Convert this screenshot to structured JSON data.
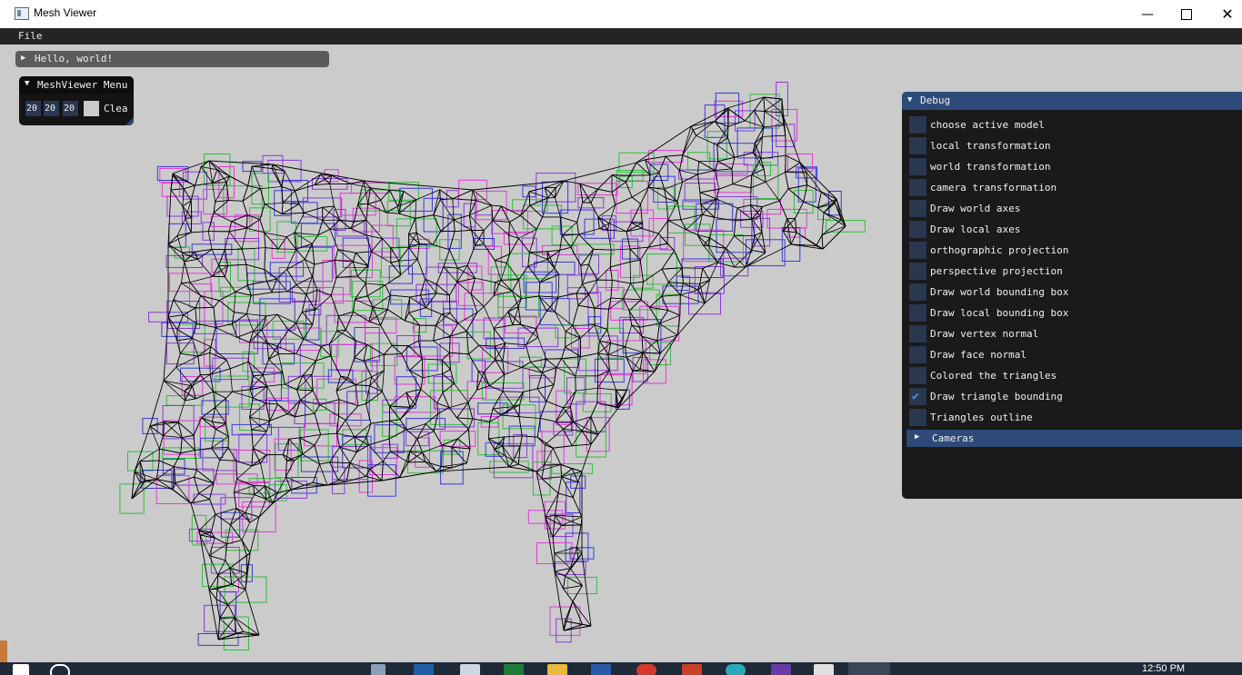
{
  "window": {
    "title": "Mesh Viewer",
    "minimize_icon": "minimize-icon",
    "maximize_icon": "maximize-icon",
    "close_icon": "close-icon"
  },
  "menubar": {
    "file": "File"
  },
  "hello_window": {
    "title": "Hello, world!"
  },
  "meshviewer_menu": {
    "title": "MeshViewer Menu",
    "color_values": [
      "20",
      "20",
      "20"
    ],
    "clear_label": "Clea"
  },
  "debug": {
    "title": "Debug",
    "options": [
      {
        "label": "choose active model",
        "checked": false
      },
      {
        "label": "local transformation",
        "checked": false
      },
      {
        "label": "world transformation",
        "checked": false
      },
      {
        "label": "camera transformation",
        "checked": false
      },
      {
        "label": "Draw world axes",
        "checked": false
      },
      {
        "label": "Draw local axes",
        "checked": false
      },
      {
        "label": "orthographic projection",
        "checked": false
      },
      {
        "label": "perspective projection",
        "checked": false
      },
      {
        "label": "Draw world bounding box",
        "checked": false
      },
      {
        "label": "Draw local bounding box",
        "checked": false
      },
      {
        "label": "Draw vertex normal",
        "checked": false
      },
      {
        "label": "Draw face normal",
        "checked": false
      },
      {
        "label": "Colored the triangles",
        "checked": false
      },
      {
        "label": "Draw triangle bounding",
        "checked": true
      },
      {
        "label": "Triangles outline",
        "checked": false
      }
    ],
    "cameras_label": "Cameras"
  },
  "taskbar": {
    "clock": "12:50 PM"
  },
  "colors": {
    "panel_bg": "#1a1a1a",
    "header_blue": "#2d4a78",
    "checkbox_bg": "#29374f",
    "check_blue": "#4d8fe0",
    "viewport_bg": "#cbcbcb"
  }
}
